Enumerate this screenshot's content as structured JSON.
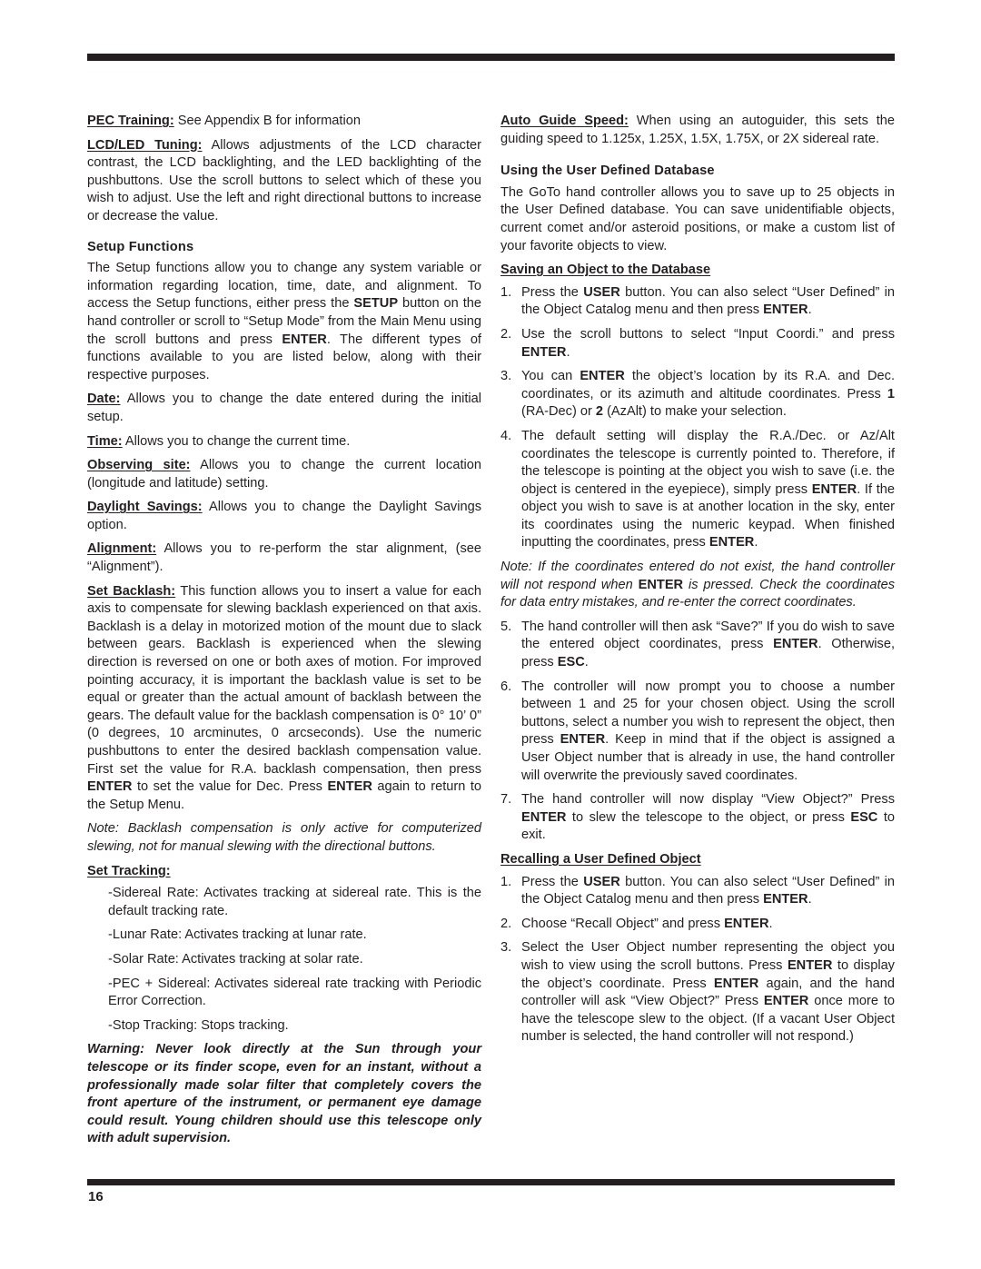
{
  "page": {
    "number": "16"
  },
  "left": {
    "pec_training": {
      "term": "PEC Training:",
      "text": " See Appendix B for information"
    },
    "lcd_tuning": {
      "term": "LCD/LED Tuning:",
      "text": " Allows adjustments of the LCD character contrast, the LCD backlighting, and the LED backlighting of the pushbuttons. Use the scroll buttons to select which of these you wish to adjust. Use the left and right directional buttons to increase or decrease the value."
    },
    "setup_heading": "Setup Functions",
    "setup_intro": {
      "a": "The Setup functions allow you to change any system variable or information regarding location, time, date, and alignment. To access the Setup functions, either press the ",
      "b1": "SETUP",
      "c": " button on the hand controller or scroll to “Setup Mode” from the Main Menu using the scroll buttons and press ",
      "b2": "ENTER",
      "d": ". The different types of functions available to you are listed below, along with their respective purposes."
    },
    "date": {
      "term": "Date:",
      "text": " Allows you to change the date entered during the initial setup."
    },
    "time": {
      "term": "Time:",
      "text": " Allows you to change the current time."
    },
    "observing_site": {
      "term": "Observing site:",
      "text": " Allows you to change the current location (longitude and latitude) setting."
    },
    "daylight_savings": {
      "term": "Daylight Savings:",
      "text": " Allows you to change the Daylight Savings option."
    },
    "alignment": {
      "term": "Alignment:",
      "text": " Allows you to re-perform the star alignment, (see “Alignment”)."
    },
    "set_backlash": {
      "term": "Set Backlash:",
      "a": " This function allows you to insert a value for each axis to compensate for slewing backlash experienced on that axis. Backlash is a delay in motorized motion of the mount due to slack between gears. Backlash is experienced when the slewing direction is reversed on one or both axes of motion. For improved pointing accuracy, it is important the backlash value is set to be equal or greater than the actual amount of backlash between the gears. The default value for the backlash compensation is 0° 10’ 0” (0 degrees, 10 arcminutes, 0 arcseconds). Use the numeric pushbuttons to enter the desired backlash compensation value. First set the value for R.A. backlash compensation, then press ",
      "b1": "ENTER",
      "c": " to set the value for Dec. Press ",
      "b2": "ENTER",
      "d": " again to return to the Setup Menu."
    },
    "backlash_note": "Note: Backlash compensation is only active for computerized slewing, not for manual slewing with the directional buttons.",
    "set_tracking_heading": "Set Tracking:",
    "tracking_options": [
      "-Sidereal Rate: Activates tracking at sidereal rate. This is the default tracking rate.",
      "-Lunar Rate: Activates tracking at lunar rate.",
      "-Solar Rate: Activates tracking at solar rate.",
      "-PEC + Sidereal: Activates sidereal rate tracking with Periodic Error Correction.",
      "-Stop Tracking: Stops tracking."
    ],
    "warning": "Warning: Never look directly at the Sun through your telescope or its finder scope, even for an instant, without a professionally made solar filter that completely covers the front aperture of the instrument, or permanent eye damage could result. Young children should use this telescope only with adult supervision."
  },
  "right": {
    "auto_guide": {
      "term": "Auto Guide Speed:",
      "text": " When using an autoguider, this sets the guiding speed to 1.125x, 1.25X, 1.5X, 1.75X, or 2X sidereal rate."
    },
    "user_db_heading": "Using the User Defined Database",
    "user_db_intro": "The GoTo hand controller allows you to save up to 25 objects in the User Defined database. You can save unidentifiable objects, current comet and/or asteroid positions, or make a custom list of your favorite objects to view.",
    "saving_heading": "Saving an Object to the Database",
    "saving_steps": {
      "s1": {
        "num": "1.",
        "a": "Press the ",
        "b1": "USER",
        "c": " button. You can also select “User Defined” in the Object Catalog menu and then press ",
        "b2": "ENTER",
        "d": "."
      },
      "s2": {
        "num": "2.",
        "a": "Use the scroll buttons to select “Input Coordi.” and press ",
        "b1": "ENTER",
        "c": "."
      },
      "s3": {
        "num": "3.",
        "a": "You can ",
        "b1": "ENTER",
        "c": " the object’s location by its R.A. and Dec. coordinates, or its azimuth and altitude coordinates. Press ",
        "b2": "1",
        "d": " (RA-Dec) or ",
        "b3": "2",
        "e": " (AzAlt) to make your selection."
      },
      "s4": {
        "num": "4.",
        "a": "The default setting will display the R.A./Dec. or Az/Alt coordinates the telescope is currently pointed to. Therefore, if the telescope is pointing at the object you wish to save (i.e. the object is centered in the eyepiece), simply press ",
        "b1": "ENTER",
        "c": ". If the object you wish to save is at another location in the sky, enter its coordinates using the numeric keypad. When finished inputting the coordinates, press ",
        "b2": "ENTER",
        "d": "."
      },
      "note": {
        "a": "Note: If the coordinates entered do not exist, the hand controller will not respond when ",
        "b1": "ENTER",
        "c": " is pressed. Check the coordinates for data entry mistakes, and re-enter the correct coordinates."
      },
      "s5": {
        "num": "5.",
        "a": "The hand controller will then ask “Save?” If you do wish to save the entered object coordinates, press ",
        "b1": "ENTER",
        "c": ". Otherwise, press ",
        "b2": "ESC",
        "d": "."
      },
      "s6": {
        "num": "6.",
        "a": "The controller will now prompt you to choose a number between 1 and 25 for your chosen object. Using the scroll buttons, select a number you wish to represent the object, then press ",
        "b1": "ENTER",
        "c": ". Keep in mind that if the object is assigned a User Object number that is already in use, the hand controller will overwrite the previously saved coordinates."
      },
      "s7": {
        "num": "7.",
        "a": "The hand controller will now display “View Object?” Press ",
        "b1": "ENTER",
        "c": " to slew the telescope to the object, or press ",
        "b2": "ESC",
        "d": " to exit."
      }
    },
    "recall_heading": "Recalling a User Defined Object",
    "recall_steps": {
      "r1": {
        "num": "1.",
        "a": "Press the ",
        "b1": "USER",
        "c": " button. You can also select “User Defined” in the Object Catalog menu and then press ",
        "b2": "ENTER",
        "d": "."
      },
      "r2": {
        "num": "2.",
        "a": "Choose “Recall Object” and press ",
        "b1": "ENTER",
        "c": "."
      },
      "r3": {
        "num": "3.",
        "a": "Select the User Object number representing the object you wish to view using the scroll buttons. Press ",
        "b1": "ENTER",
        "c": " to display the object’s coordinate. Press ",
        "b2": "ENTER",
        "d": " again, and the hand controller will ask “View Object?” Press ",
        "b3": "ENTER",
        "e": " once more to have the telescope slew to the object. (If a vacant User Object number is selected, the hand controller will not respond.)"
      }
    }
  }
}
